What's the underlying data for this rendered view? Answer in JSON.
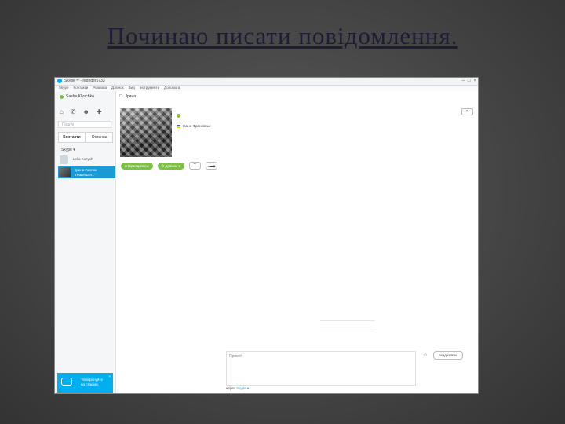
{
  "slide": {
    "title": "Починаю писати повідомлення."
  },
  "window": {
    "title": "Skype™ - redrider5733",
    "controls": [
      "–",
      "□",
      "×"
    ]
  },
  "menu": [
    "Skype",
    "Контакти",
    "Розмова",
    "Дзвінок",
    "Вид",
    "Інструменти",
    "Допомога"
  ],
  "sidebar": {
    "status_name": "Sasha Klyuchko",
    "search_placeholder": "Пошук",
    "tabs": [
      "Контакти",
      "Останнє"
    ],
    "group_label": "Skype ▾",
    "contacts": [
      {
        "name": "Lelia Kuzych"
      },
      {
        "name": "Ірина Гнатюк",
        "line2": "Пишеться..."
      }
    ],
    "promo": {
      "line1": "Телефонуйте",
      "line2": "на стаціон.",
      "close": "×"
    }
  },
  "main": {
    "header_name": "Ірина",
    "location": "Івано-Франківськ",
    "expand_label": "⇱",
    "video_call_label": "Відеодзвінок",
    "call_label": "Дзвінок ▾",
    "add_label": "+",
    "compose_placeholder": "Привіт!",
    "send_label": "Надіслати",
    "via_prefix": "через",
    "via_value": "Skype ▾"
  },
  "colors": {
    "accent": "#00aff0",
    "green": "#7cc242",
    "selection": "#1c9ad6"
  }
}
